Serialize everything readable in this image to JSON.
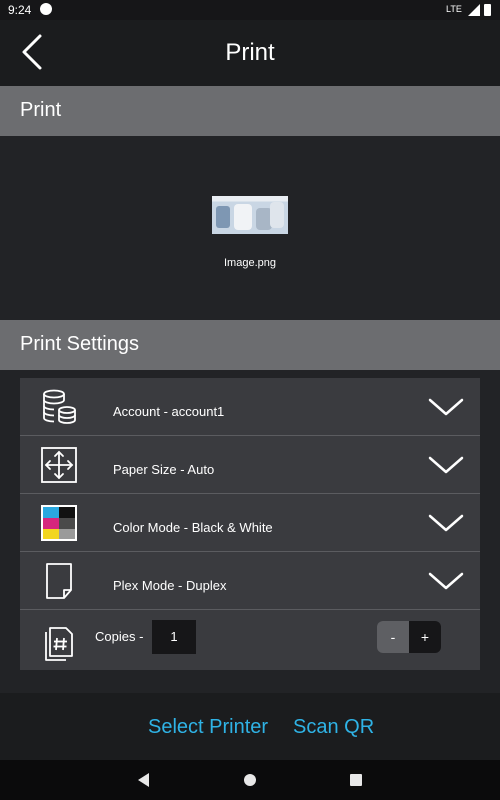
{
  "status_bar": {
    "time": "9:24",
    "network": "LTE"
  },
  "app_bar": {
    "title": "Print",
    "back_icon": "chevron-left-icon"
  },
  "print_section": {
    "header": "Print",
    "file": {
      "name": "Image.png",
      "thumbnail_icon": "image-thumbnail"
    }
  },
  "settings_section": {
    "header": "Print Settings",
    "rows": [
      {
        "label": "Account - account1",
        "icon": "database-coins-icon"
      },
      {
        "label": "Paper Size - Auto",
        "icon": "resize-arrows-icon"
      },
      {
        "label": "Color Mode - Black & White",
        "icon": "color-swatch-icon"
      },
      {
        "label": "Plex Mode - Duplex",
        "icon": "page-icon"
      }
    ],
    "copies": {
      "label": "Copies -",
      "value": "1",
      "minus": "-",
      "plus": "+",
      "icon": "copies-hash-icon"
    }
  },
  "actions": {
    "select_printer": "Select Printer",
    "scan_qr": "Scan QR"
  },
  "colors": {
    "accent": "#2fb3e6",
    "background": "#222326",
    "header_bg": "#6c6d70",
    "card_bg": "#3a3b3f"
  }
}
